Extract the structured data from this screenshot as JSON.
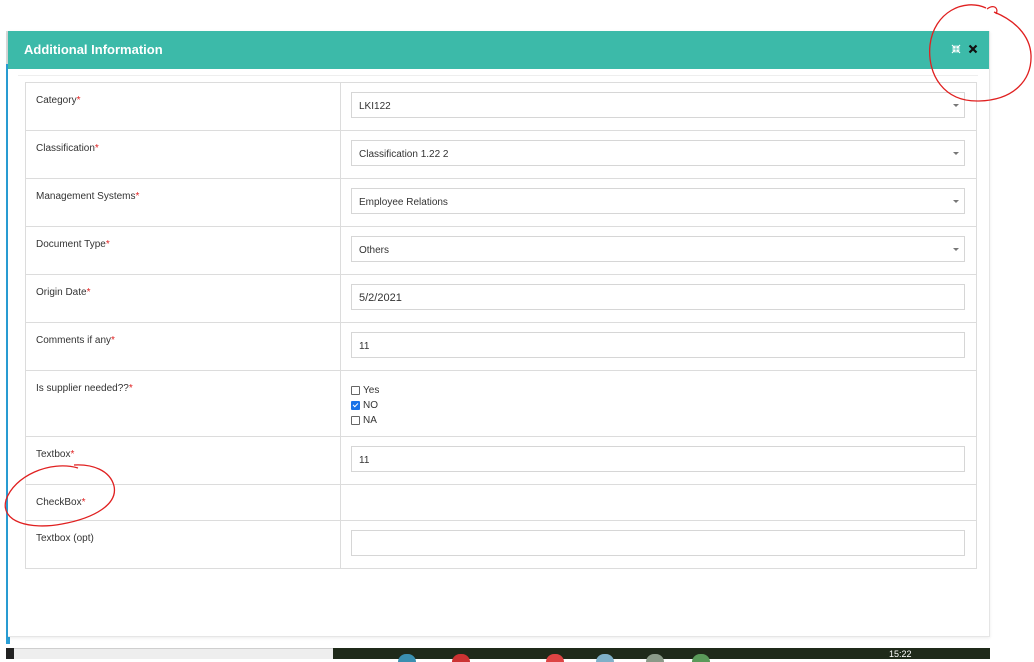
{
  "modal": {
    "title": "Additional Information",
    "header_color": "#3cbaa9",
    "icons": [
      "collapse-icon",
      "close-icon"
    ]
  },
  "form": {
    "required_marker": "*",
    "rows": [
      {
        "label": "Category",
        "type": "select",
        "value": "LKI122"
      },
      {
        "label": "Classification",
        "type": "select",
        "value": "Classification 1.22 2"
      },
      {
        "label": "Management Systems",
        "type": "select",
        "value": "Employee Relations"
      },
      {
        "label": "Document Type",
        "type": "select",
        "value": "Others"
      },
      {
        "label": "Origin Date",
        "type": "input",
        "value": "5/2/2021"
      },
      {
        "label": "Comments if any",
        "type": "input",
        "value": "11"
      },
      {
        "label": "Is supplier needed??",
        "type": "checkbox",
        "options": [
          {
            "label": "Yes",
            "checked": false
          },
          {
            "label": "NO",
            "checked": true
          },
          {
            "label": "NA",
            "checked": false
          }
        ]
      },
      {
        "label": "Textbox",
        "type": "input",
        "value": "11"
      },
      {
        "label": "CheckBox",
        "type": "empty"
      },
      {
        "label": "Textbox (opt)",
        "type": "input",
        "value": ""
      }
    ]
  },
  "taskbar": {
    "time": "15:22"
  }
}
